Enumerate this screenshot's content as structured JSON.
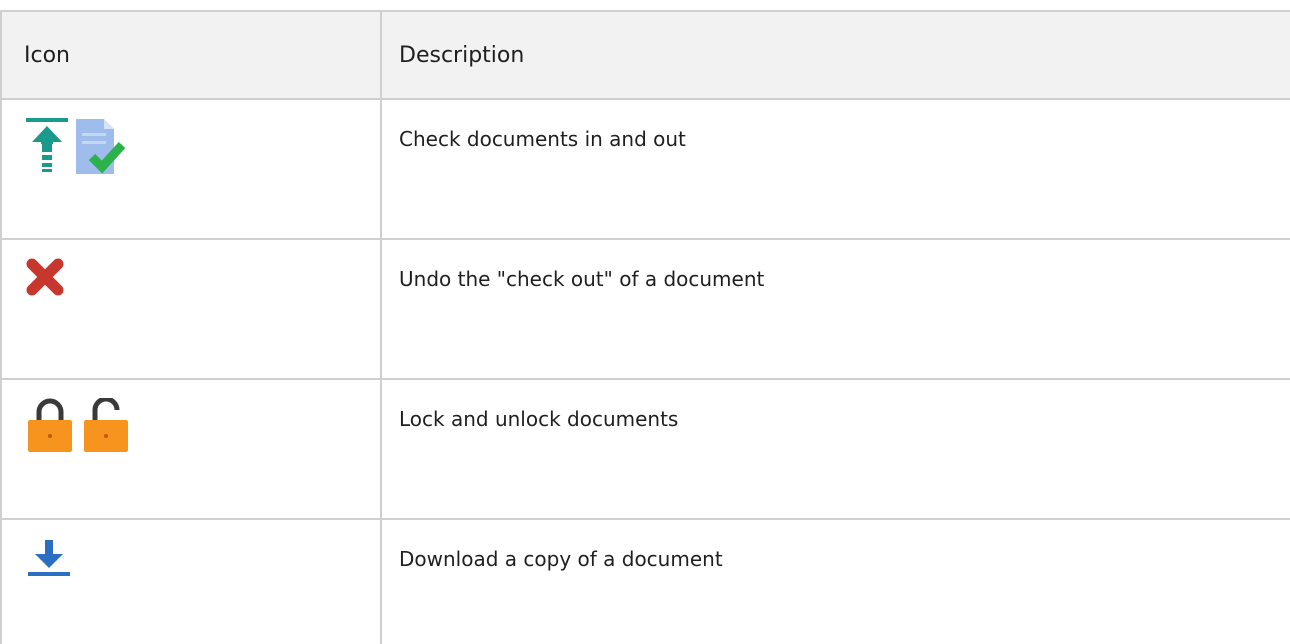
{
  "table": {
    "headers": {
      "icon": "Icon",
      "description": "Description"
    },
    "rows": [
      {
        "icons": [
          "check-in-arrow-icon",
          "checked-document-icon"
        ],
        "description": "Check documents in and out"
      },
      {
        "icons": [
          "red-x-icon"
        ],
        "description": "Undo the \"check out\" of a document"
      },
      {
        "icons": [
          "locked-padlock-icon",
          "unlocked-padlock-icon"
        ],
        "description": "Lock and unlock documents"
      },
      {
        "icons": [
          "download-arrow-icon"
        ],
        "description": "Download a copy of a document"
      }
    ]
  },
  "colors": {
    "header_bg": "#f2f2f2",
    "border": "#cfcfcf",
    "teal": "#1a9a8c",
    "doc_blue": "#7fa6e0",
    "green_check": "#2bb24a",
    "red_x": "#c8372d",
    "lock_orange": "#f7941d",
    "download_blue": "#2b6fc2"
  }
}
